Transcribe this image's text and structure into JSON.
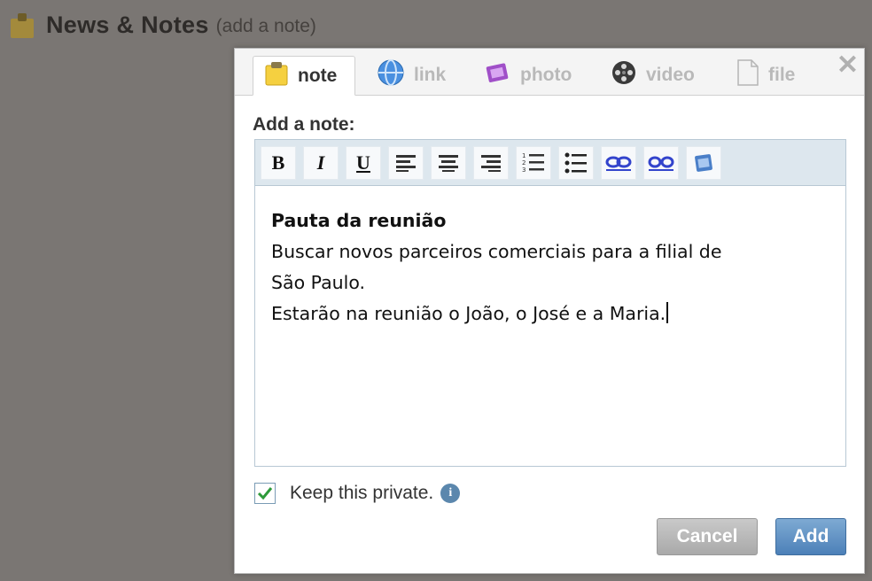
{
  "background": {
    "title": "News & Notes",
    "subtitle": "(add a note)",
    "notepad_icon": "notepad-icon"
  },
  "dialog": {
    "tabs": [
      {
        "label": "note",
        "icon": "notepad-icon",
        "active": true
      },
      {
        "label": "link",
        "icon": "globe-icon",
        "active": false
      },
      {
        "label": "photo",
        "icon": "photo-icon",
        "active": false
      },
      {
        "label": "video",
        "icon": "film-reel-icon",
        "active": false
      },
      {
        "label": "file",
        "icon": "document-icon",
        "active": false
      }
    ],
    "close_glyph": "✕",
    "label": "Add a note:",
    "toolbar": {
      "bold": "B",
      "italic": "I",
      "underline": "U"
    },
    "content": {
      "heading": "Pauta da reunião",
      "line1": "Buscar novos parceiros comerciais para a filial de",
      "line2": "São Paulo.",
      "line3": "Estarão na reunião o João, o José e a Maria."
    },
    "private_label": "Keep this private.",
    "private_checked": true,
    "cancel_label": "Cancel",
    "add_label": "Add"
  },
  "colors": {
    "overlay": "#7a7673",
    "toolbar_bg": "#dde7ee",
    "add_button": "#5a8cc0",
    "link_icon": "#3344cc"
  }
}
